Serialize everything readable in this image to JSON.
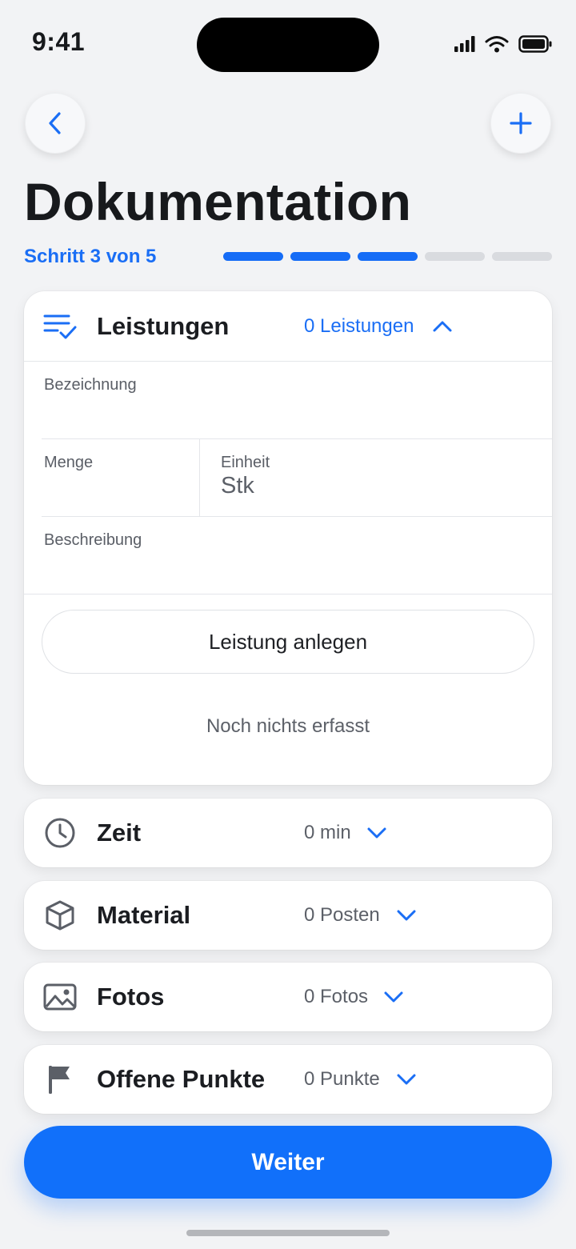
{
  "status_bar": {
    "time": "9:41"
  },
  "header": {
    "title": "Dokumentation",
    "step_label": "Schritt 3 von 5"
  },
  "progress": {
    "current_step": 3,
    "total_steps": 5
  },
  "sections": {
    "leistungen": {
      "title": "Leistungen",
      "meta": "0 Leistungen",
      "icon": "checklist-icon",
      "fields": {
        "bezeichnung_label": "Bezeichnung",
        "bezeichnung_value": "",
        "menge_label": "Menge",
        "menge_value": "",
        "einheit_label": "Einheit",
        "einheit_value": "Stk",
        "beschreibung_label": "Beschreibung",
        "beschreibung_value": ""
      },
      "create_button": "Leistung anlegen",
      "empty_text": "Noch nichts erfasst"
    },
    "zeit": {
      "title": "Zeit",
      "meta": "0 min",
      "icon": "clock-icon"
    },
    "material": {
      "title": "Material",
      "meta": "0 Posten",
      "icon": "box-icon"
    },
    "fotos": {
      "title": "Fotos",
      "meta": "0 Fotos",
      "icon": "image-icon"
    },
    "offene_punkte": {
      "title": "Offene Punkte",
      "meta": "0 Punkte",
      "icon": "flag-icon"
    }
  },
  "footer": {
    "primary_button": "Weiter"
  },
  "colors": {
    "accent": "#1170fa",
    "background": "#f2f3f5"
  }
}
